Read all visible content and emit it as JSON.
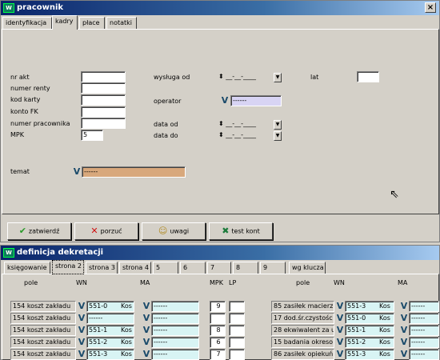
{
  "win1": {
    "title": "pracownik",
    "close": "×",
    "tabs": [
      "identyfikacja",
      "kadry",
      "płace",
      "notatki"
    ],
    "left_labels": [
      "nr akt",
      "numer renty",
      "kod karty",
      "konto FK",
      "numer pracownika",
      "MPK"
    ],
    "mpk_value": "5",
    "wysluga_label": "wysługa od",
    "lat_label": "lat",
    "operator_label": "operator",
    "operator_value": "------",
    "data_od_label": "data  od",
    "data_do_label": "data do",
    "date_placeholder": "__-__-____",
    "temat_label": "temat",
    "temat_value": "------",
    "buttons": [
      {
        "label": "zatwierdź",
        "icon": "✔"
      },
      {
        "label": "porzuć",
        "icon": "✕"
      },
      {
        "label": "uwagi",
        "icon": "☺"
      },
      {
        "label": "test kont",
        "icon": "✖"
      }
    ]
  },
  "win2": {
    "title": "definicja dekretacji",
    "tabs": [
      "księgowanie",
      "strona 2",
      "strona 3",
      "strona 4",
      "5",
      "6",
      "7",
      "8",
      "9",
      "wg klucza"
    ],
    "headers": {
      "pole": "pole",
      "wn": "WN",
      "ma": "MA",
      "mpk": "MPK",
      "lp": "LP",
      "pole2": "pole",
      "wn2": "WN",
      "ma2": "MA"
    },
    "rows_left": [
      {
        "pole": "154  koszt zakładu",
        "wn": "551-0",
        "wn_kos": "Kos",
        "ma": "------",
        "mpk": "9"
      },
      {
        "pole": "154  koszt zakładu",
        "wn": "------",
        "wn_kos": "",
        "ma": "------",
        "mpk": ""
      },
      {
        "pole": "154  koszt zakładu",
        "wn": "551-1",
        "wn_kos": "Kos",
        "ma": "------",
        "mpk": "8"
      },
      {
        "pole": "154  koszt zakładu",
        "wn": "551-2",
        "wn_kos": "Kos",
        "ma": "------",
        "mpk": "6"
      },
      {
        "pole": "154  koszt zakładu",
        "wn": "551-3",
        "wn_kos": "Kos",
        "ma": "------",
        "mpk": "7"
      }
    ],
    "rows_right": [
      {
        "pole": "85  zasiłek macierz",
        "wn": "551-3",
        "wn_kos": "Kos",
        "ma": "------"
      },
      {
        "pole": "17  dod.śr.czystośc",
        "wn": "551-0",
        "wn_kos": "Kos",
        "ma": "------"
      },
      {
        "pole": "28  ekwiwalent za u",
        "wn": "551-1",
        "wn_kos": "Kos",
        "ma": "------"
      },
      {
        "pole": "15  badania okreso",
        "wn": "551-2",
        "wn_kos": "Kos",
        "ma": "------"
      },
      {
        "pole": "86  zasiłek opiekuń",
        "wn": "551-3",
        "wn_kos": "Kos",
        "ma": "------"
      }
    ]
  }
}
